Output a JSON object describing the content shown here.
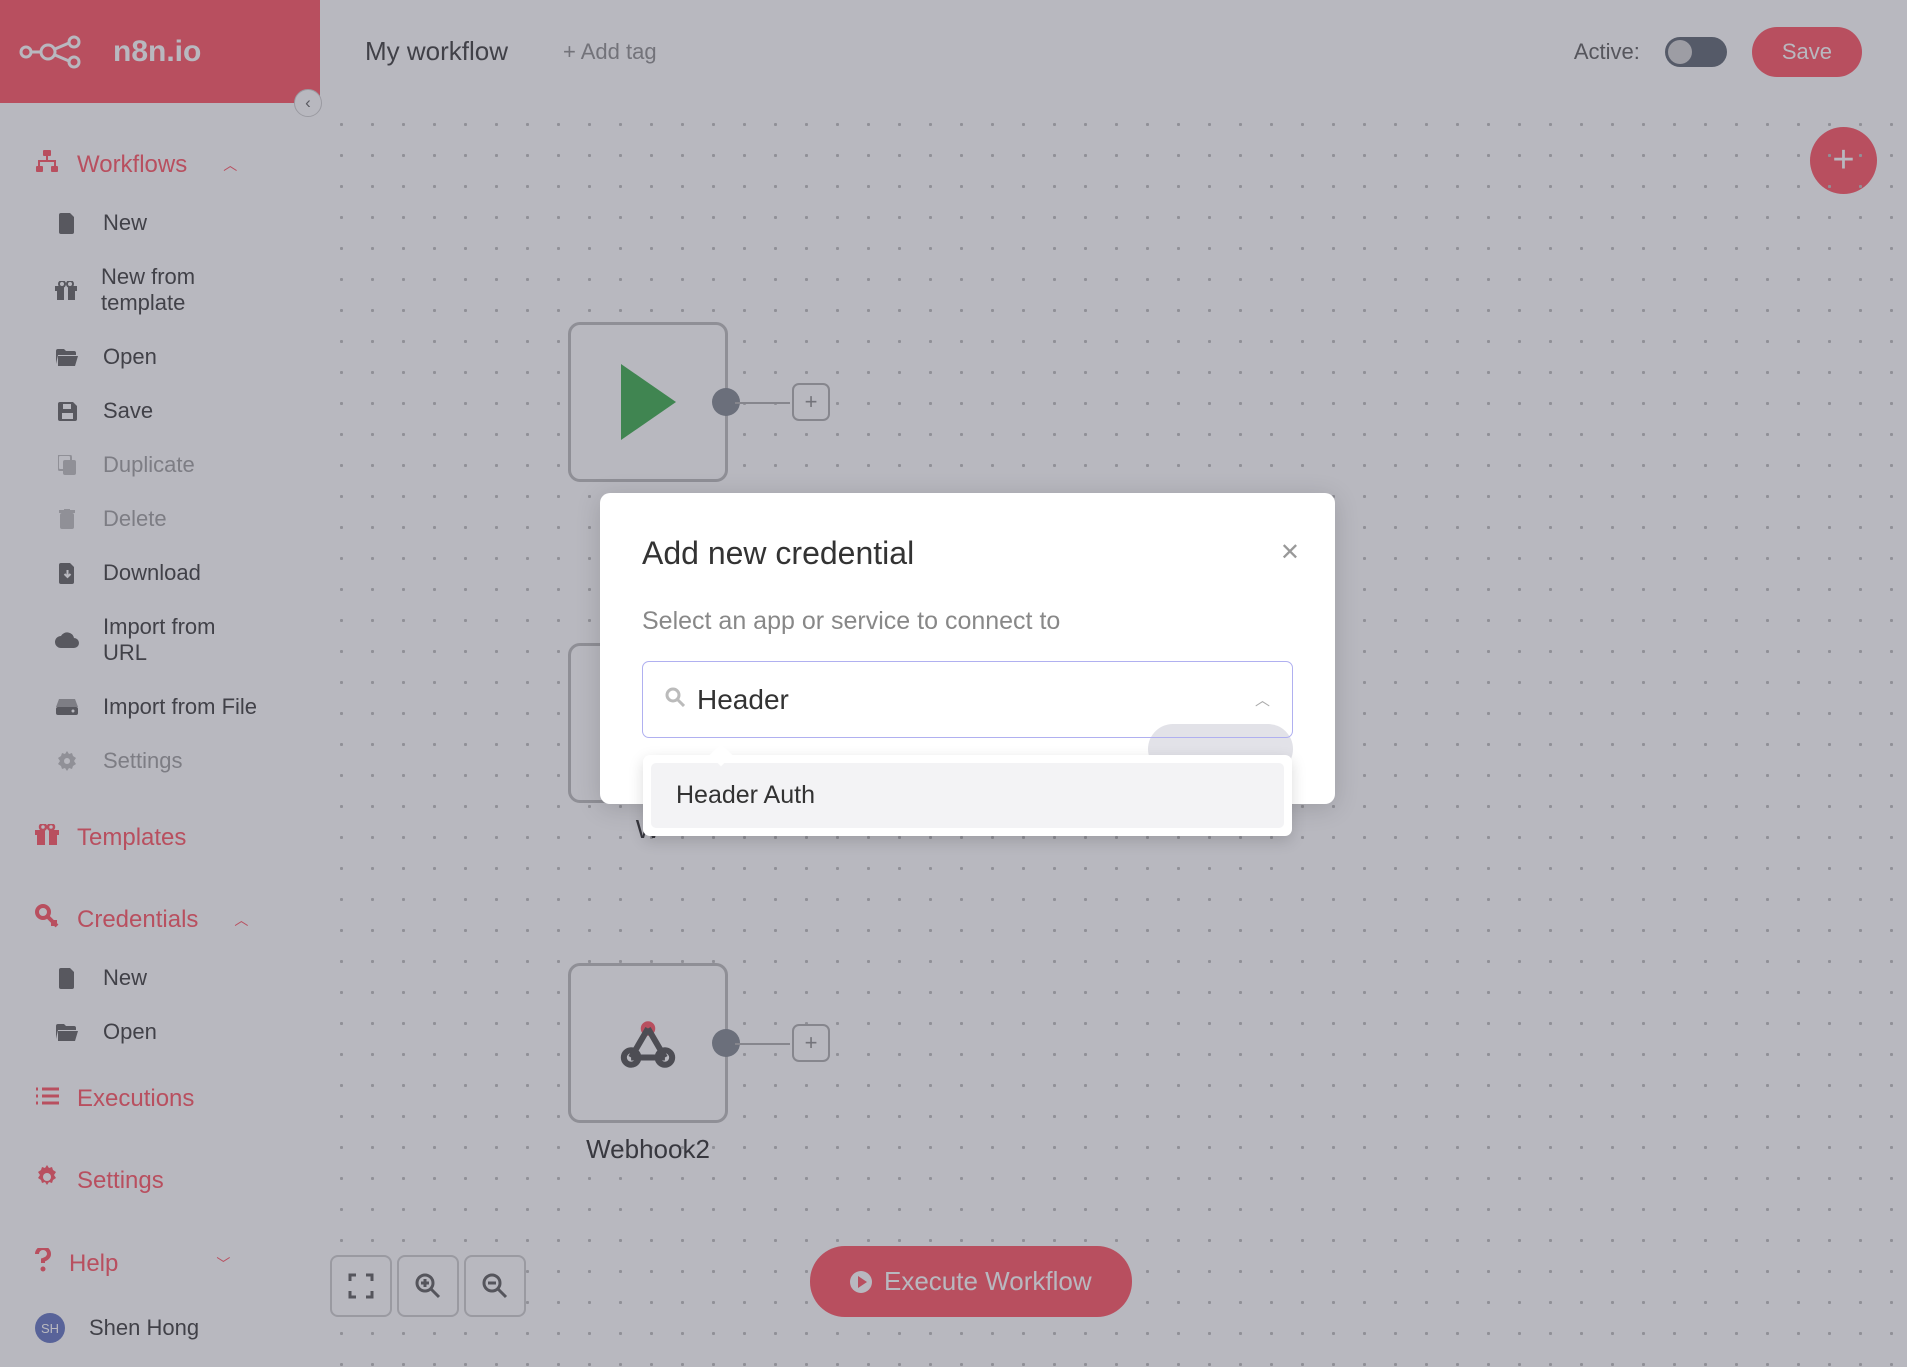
{
  "brand": {
    "text": "n8n.io"
  },
  "sidebar": {
    "workflows": {
      "label": "Workflows",
      "items": [
        {
          "label": "New",
          "icon": "file-icon",
          "disabled": false
        },
        {
          "label": "New from template",
          "icon": "gift-icon",
          "disabled": false
        },
        {
          "label": "Open",
          "icon": "folder-open-icon",
          "disabled": false
        },
        {
          "label": "Save",
          "icon": "save-icon",
          "disabled": false
        },
        {
          "label": "Duplicate",
          "icon": "copy-icon",
          "disabled": true
        },
        {
          "label": "Delete",
          "icon": "trash-icon",
          "disabled": true
        },
        {
          "label": "Download",
          "icon": "download-icon",
          "disabled": false
        },
        {
          "label": "Import from URL",
          "icon": "cloud-icon",
          "disabled": false
        },
        {
          "label": "Import from File",
          "icon": "drive-icon",
          "disabled": false
        },
        {
          "label": "Settings",
          "icon": "gear-icon",
          "disabled": true
        }
      ]
    },
    "templates": {
      "label": "Templates"
    },
    "credentials": {
      "label": "Credentials",
      "items": [
        {
          "label": "New",
          "icon": "file-icon"
        },
        {
          "label": "Open",
          "icon": "folder-open-icon"
        }
      ]
    },
    "executions": {
      "label": "Executions"
    },
    "settings": {
      "label": "Settings"
    },
    "help": {
      "label": "Help"
    }
  },
  "user": {
    "initials": "SH",
    "name": "Shen Hong"
  },
  "topbar": {
    "workflow_name": "My workflow",
    "add_tag": "+ Add tag",
    "active_label": "Active:",
    "save": "Save"
  },
  "nodes": {
    "start": {
      "label": ""
    },
    "webhook1": {
      "label": "W"
    },
    "webhook2": {
      "label": "Webhook2"
    }
  },
  "execute_button": "Execute Workflow",
  "modal": {
    "title": "Add new credential",
    "subtitle": "Select an app or service to connect to",
    "search_value": "Header",
    "options": [
      {
        "label": "Header Auth"
      }
    ]
  }
}
